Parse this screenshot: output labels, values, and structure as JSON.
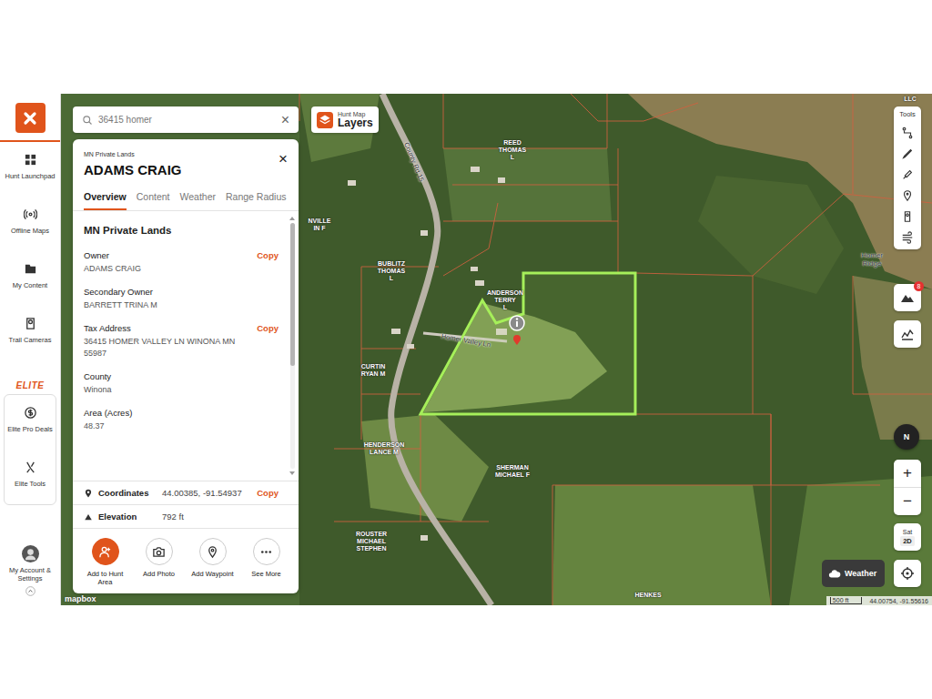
{
  "sidebar": {
    "items": [
      {
        "label": "Hunt Launchpad",
        "selected": false
      },
      {
        "label": "Offline Maps",
        "selected": false
      },
      {
        "label": "My Content",
        "selected": false
      },
      {
        "label": "Trail Cameras",
        "selected": false
      }
    ],
    "elite": {
      "brand": "ELITE",
      "items": [
        {
          "label": "Elite Pro Deals"
        },
        {
          "label": "Elite Tools"
        }
      ]
    },
    "account": {
      "label": "My Account & Settings"
    }
  },
  "search": {
    "value": "36415 homer",
    "clear": "×"
  },
  "layers": {
    "caption": "Hunt Map",
    "label": "Layers"
  },
  "panel": {
    "category": "MN Private Lands",
    "title": "ADAMS CRAIG",
    "close": "×",
    "tabs": [
      {
        "label": "Overview",
        "selected": true
      },
      {
        "label": "Content",
        "selected": false
      },
      {
        "label": "Weather",
        "selected": false
      },
      {
        "label": "Range Radius",
        "selected": false
      }
    ],
    "section": "MN Private Lands",
    "fields": [
      {
        "label": "Owner",
        "value": "ADAMS CRAIG",
        "action": "Copy"
      },
      {
        "label": "Secondary Owner",
        "value": "BARRETT TRINA M"
      },
      {
        "label": "Tax Address",
        "value": "36415 HOMER VALLEY LN WINONA MN 55987",
        "action": "Copy"
      },
      {
        "label": "County",
        "value": "Winona"
      },
      {
        "label": "Area (Acres)",
        "value": "48.37"
      }
    ],
    "scroll": {
      "level": 0.58
    },
    "details": [
      {
        "label": "Coordinates",
        "value": "44.00385, -91.54937",
        "action": "Copy"
      },
      {
        "label": "Elevation",
        "value": "792 ft"
      }
    ],
    "actions": [
      {
        "label": "Add to Hunt Area",
        "primary": true
      },
      {
        "label": "Add Photo",
        "primary": false
      },
      {
        "label": "Add Waypoint",
        "primary": false
      },
      {
        "label": "See More",
        "primary": false
      }
    ]
  },
  "toolbar": {
    "title": "Tools",
    "badge": "8"
  },
  "map": {
    "roads": [
      {
        "label": "County Rd 15"
      },
      {
        "label": "Homer Valley Ln"
      }
    ],
    "parcels": [
      {
        "lines": [
          "REED",
          "THOMAS",
          "L"
        ]
      },
      {
        "lines": [
          "ANDERSON",
          "TERRY",
          "L"
        ]
      },
      {
        "lines": [
          "BUBLITZ",
          "THOMAS",
          "L"
        ]
      },
      {
        "lines": [
          "CURTIN",
          "RYAN M"
        ]
      },
      {
        "lines": [
          "HENDERSON",
          "LANCE M"
        ]
      },
      {
        "lines": [
          "SHERMAN",
          "MICHAEL F"
        ]
      },
      {
        "lines": [
          "ROUSTER",
          "MICHAEL",
          "STEPHEN"
        ]
      },
      {
        "lines": [
          "HENKES"
        ]
      },
      {
        "lines": [
          "NVILLE",
          "IN F"
        ]
      },
      {
        "lines": [
          "LLC"
        ]
      }
    ],
    "places": [
      {
        "lines": [
          "Homer",
          "Ridge"
        ]
      }
    ]
  },
  "controls": {
    "compass": "N",
    "zoom_in": "+",
    "zoom_out": "−",
    "map_type": "Sat",
    "view_mode": "2D",
    "weather": "Weather"
  },
  "attribution": "mapbox",
  "scale": {
    "label": "500 ft",
    "coordinates": "44.00754, -91.55616"
  }
}
